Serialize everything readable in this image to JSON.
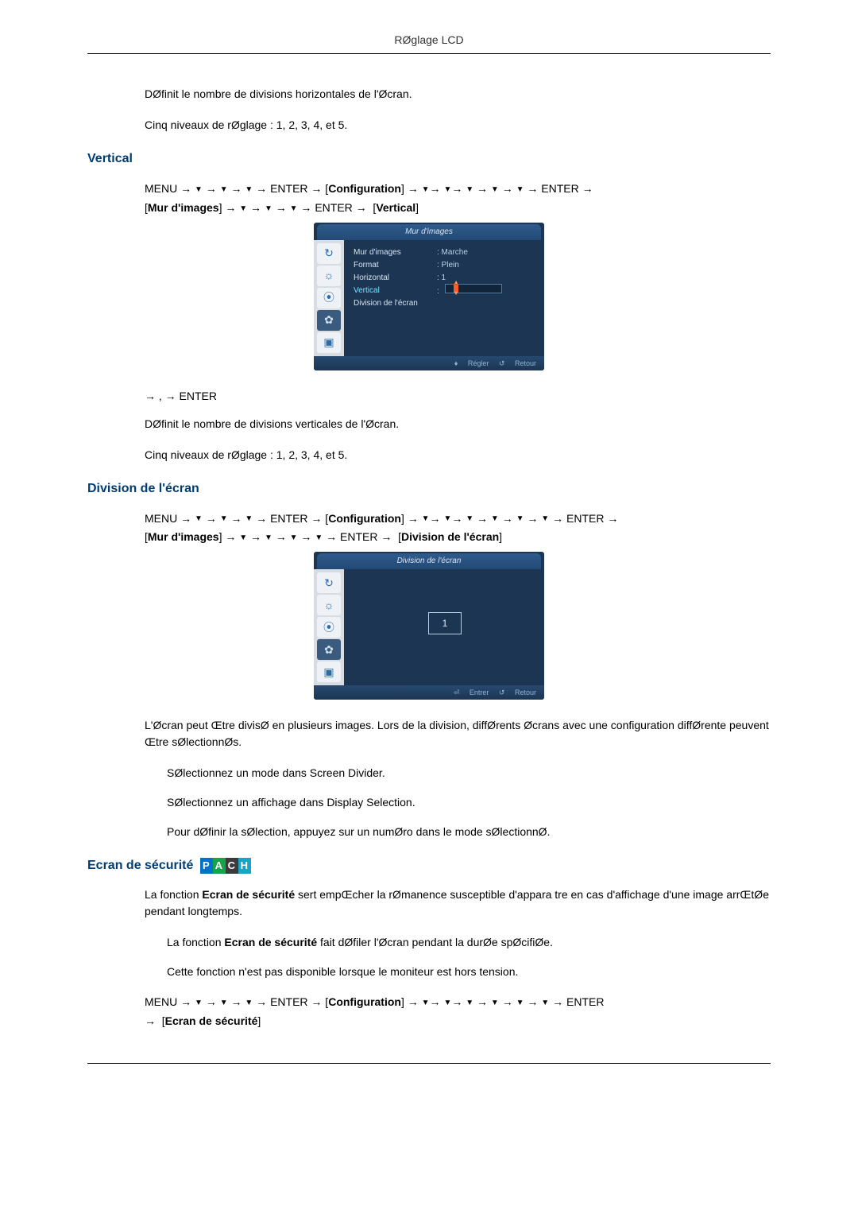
{
  "header": "RØglage LCD",
  "intro": {
    "p1": "DØfinit le nombre de divisions horizontales de l'Øcran.",
    "p2": "Cinq niveaux de rØglage : 1, 2, 3, 4, et 5."
  },
  "sections": {
    "vertical": {
      "title": "Vertical",
      "nav": {
        "menu": "MENU",
        "enter": "ENTER",
        "configuration": "Configuration",
        "bracket_mur": "Mur d'images",
        "bracket_target": "Vertical"
      },
      "osd": {
        "title": "Mur d'images",
        "rows": [
          {
            "k": "Mur d'images",
            "v": ": Marche"
          },
          {
            "k": "Format",
            "v": ": Plein"
          },
          {
            "k": "Horizontal",
            "v": ": 1"
          }
        ],
        "highlight_k": "Vertical",
        "last_row_k": "Division de l'écran",
        "footer_adjust": "Régler",
        "footer_return": "Retour",
        "footer_adjust_sym": "♦",
        "footer_return_sym": "↺"
      },
      "instr_line": " ,  : ENTER",
      "p1": "DØfinit le nombre de divisions verticales de l'Øcran.",
      "p2": "Cinq niveaux de rØglage : 1, 2, 3, 4, et 5."
    },
    "division": {
      "title": "Division de l'écran",
      "nav": {
        "menu": "MENU",
        "enter": "ENTER",
        "configuration": "Configuration",
        "bracket_mur": "Mur d'images",
        "bracket_target": "Division de l'écran"
      },
      "osd": {
        "title": "Division de l'écran",
        "selected": "1",
        "footer_enter": "Entrer",
        "footer_return": "Retour",
        "footer_enter_sym": "⏎",
        "footer_return_sym": "↺"
      },
      "p1": "L'Øcran peut Œtre divisØ en plusieurs images. Lors de la division, diffØrents Øcrans avec une configuration diffØrente peuvent Œtre sØlectionnØs.",
      "b1": "SØlectionnez un mode dans Screen Divider.",
      "b2": "SØlectionnez un affichage dans Display Selection.",
      "b3": "Pour dØfinir la sØlection, appuyez sur un numØro dans le mode sØlectionnØ."
    },
    "securite": {
      "title": "Ecran de sécurité",
      "pach": {
        "p": "P",
        "a": "A",
        "c": "C",
        "h": "H"
      },
      "p1a": "La fonction ",
      "p1b": "Ecran de sécurité",
      "p1c": " sert   empŒcher la rØmanence susceptible d'appara tre en cas d'affichage d'une image arrŒtØe pendant longtemps.",
      "b1a": "La fonction ",
      "b1b": "Ecran de sécurité",
      "b1c": " fait dØfiler l'Øcran pendant la durØe spØcifiØe.",
      "b2": "Cette fonction n'est pas disponible lorsque le moniteur est hors tension.",
      "nav": {
        "menu": "MENU",
        "enter": "ENTER",
        "configuration": "Configuration",
        "bracket_target": "Ecran de sécurité"
      }
    }
  },
  "osd_icons": {
    "i1": "↻",
    "i2": "☼",
    "i3": "⦿",
    "i4": "✿",
    "i5": "▣"
  }
}
